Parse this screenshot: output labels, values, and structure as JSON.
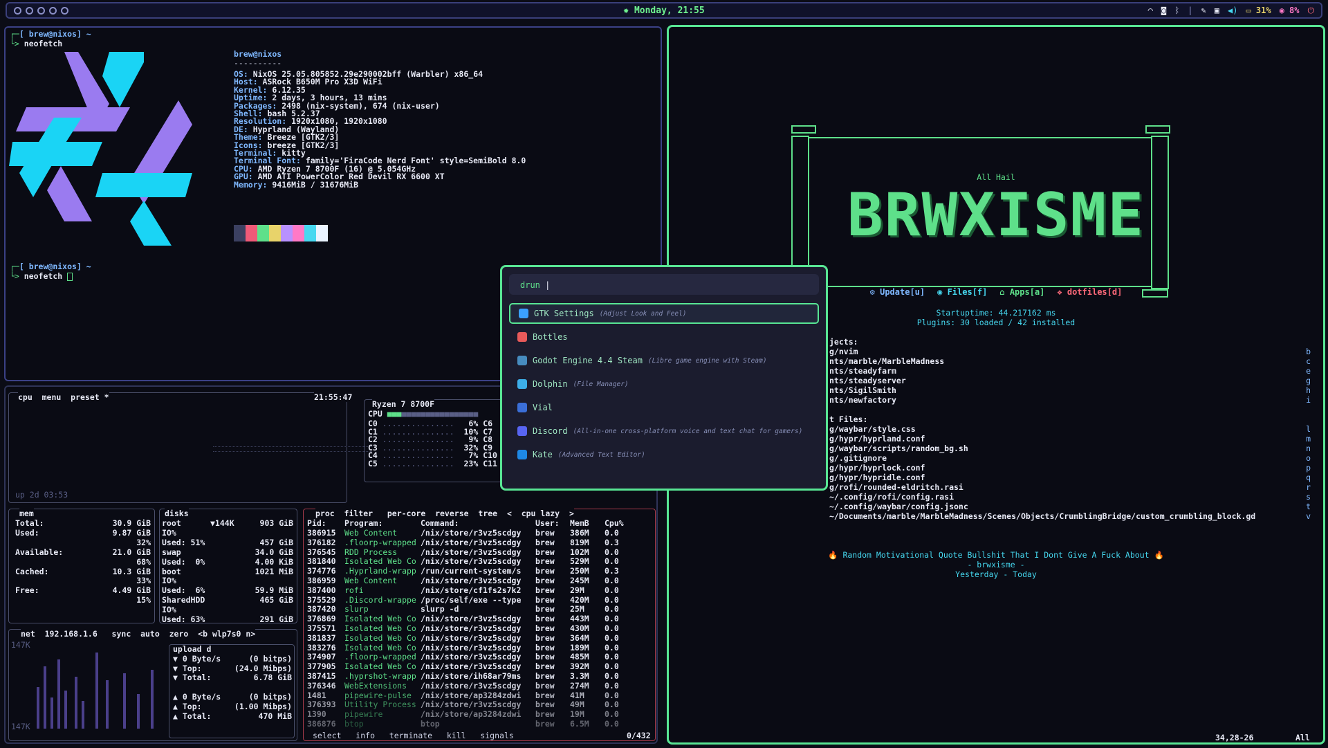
{
  "topbar": {
    "clock": "Monday, 21:55",
    "battery": "31%",
    "cpu": "8%"
  },
  "terminal": {
    "prompt1": "[ brew@nixos] ~",
    "cmd1": "neofetch",
    "user": "brew@nixos",
    "sep": "----------",
    "info": [
      [
        "OS:",
        "NixOS 25.05.805852.29e290002bff (Warbler) x86_64"
      ],
      [
        "Host:",
        "ASRock B650M Pro X3D WiFi"
      ],
      [
        "Kernel:",
        "6.12.35"
      ],
      [
        "Uptime:",
        "2 days, 3 hours, 13 mins"
      ],
      [
        "Packages:",
        "2498 (nix-system), 674 (nix-user)"
      ],
      [
        "Shell:",
        "bash 5.2.37"
      ],
      [
        "Resolution:",
        "1920x1080, 1920x1080"
      ],
      [
        "DE:",
        "Hyprland (Wayland)"
      ],
      [
        "Theme:",
        "Breeze [GTK2/3]"
      ],
      [
        "Icons:",
        "breeze [GTK2/3]"
      ],
      [
        "Terminal:",
        "kitty"
      ],
      [
        "Terminal Font:",
        "family='FiraCode Nerd Font' style=SemiBold 8.0"
      ],
      [
        "CPU:",
        "AMD Ryzen 7 8700F (16) @ 5.054GHz"
      ],
      [
        "GPU:",
        "AMD ATI PowerColor Red Devil RX 6600 XT"
      ],
      [
        "Memory:",
        "9416MiB / 31676MiB"
      ]
    ],
    "palette": [
      "#3b4061",
      "#f05a78",
      "#5ee08a",
      "#e8d36a",
      "#b891ff",
      "#ff79c6",
      "#46d8f0",
      "#eaf4ff"
    ],
    "prompt2": "[ brew@nixos] ~",
    "cmd2": "neofetch"
  },
  "btop": {
    "cpu_header": "cpu  menu  preset *",
    "time": "21:55:47",
    "uptime": "up 2d 03:53",
    "cpu_name": "Ryzen 7 8700F",
    "cores": [
      [
        "C0",
        "6%",
        "C6"
      ],
      [
        "C1",
        "10%",
        "C7"
      ],
      [
        "C2",
        "9%",
        "C8"
      ],
      [
        "C3",
        "32%",
        "C9"
      ],
      [
        "C4",
        "7%",
        "C10"
      ],
      [
        "C5",
        "23%",
        "C11"
      ]
    ],
    "mem": [
      [
        "Total:",
        "30.9 GiB"
      ],
      [
        "Used:",
        "9.87 GiB"
      ],
      [
        "",
        "32%"
      ],
      [
        "Available:",
        "21.0 GiB"
      ],
      [
        "",
        "68%"
      ],
      [
        "Cached:",
        "10.3 GiB"
      ],
      [
        "",
        "33%"
      ],
      [
        "Free:",
        "4.49 GiB"
      ],
      [
        "",
        "15%"
      ]
    ],
    "disks": [
      [
        "root",
        "▼144K",
        "903 GiB"
      ],
      [
        "IO%",
        "",
        ""
      ],
      [
        "Used: 51%",
        "",
        "457 GiB"
      ],
      [
        "swap",
        "",
        "34.0 GiB"
      ],
      [
        "Used:  0%",
        "",
        "4.00 KiB"
      ],
      [
        "boot",
        "",
        "1021 MiB"
      ],
      [
        "IO%",
        "",
        ""
      ],
      [
        "Used:  6%",
        "",
        "59.9 MiB"
      ],
      [
        "SharedHDD",
        "",
        "465 GiB"
      ],
      [
        "IO%",
        "",
        ""
      ],
      [
        "Used: 63%",
        "",
        "291 GiB"
      ]
    ],
    "net_header": "net  192.168.1.6   sync  auto  zero  <b wlp7s0 n>",
    "net_scale_top": "147K",
    "net_scale_bot": "147K",
    "net": [
      [
        "upload d",
        ""
      ],
      [
        "▼ 0 Byte/s",
        "(0 bitps)"
      ],
      [
        "▼ Top:",
        "(24.0 Mibps)"
      ],
      [
        "▼ Total:",
        "6.78 GiB"
      ],
      [
        "",
        ""
      ],
      [
        "▲ 0 Byte/s",
        "(0 bitps)"
      ],
      [
        "▲ Top:",
        "(1.00 Mibps)"
      ],
      [
        "▲ Total:",
        "470 MiB"
      ]
    ],
    "proc_header": "proc  filter   per-core  reverse  tree  <  cpu lazy  >",
    "proc_cols": [
      "Pid:",
      "Program:",
      "Command:",
      "User:",
      "MemB",
      "Cpu%"
    ],
    "procs": [
      [
        "386915",
        "Web Content",
        "/nix/store/r3vz5scdgy",
        "brew",
        "386M",
        "0.0"
      ],
      [
        "376182",
        ".floorp-wrapped",
        "/nix/store/r3vz5scdgy",
        "brew",
        "819M",
        "0.3"
      ],
      [
        "376545",
        "RDD Process",
        "/nix/store/r3vz5scdgy",
        "brew",
        "102M",
        "0.0"
      ],
      [
        "381840",
        "Isolated Web Co",
        "/nix/store/r3vz5scdgy",
        "brew",
        "529M",
        "0.0"
      ],
      [
        "374776",
        ".Hyprland-wrapp",
        "/run/current-system/s",
        "brew",
        "250M",
        "0.3"
      ],
      [
        "386959",
        "Web Content",
        "/nix/store/r3vz5scdgy",
        "brew",
        "245M",
        "0.0"
      ],
      [
        "387400",
        "rofi",
        "/nix/store/cf1fs2s7k2",
        "brew",
        "29M",
        "0.0"
      ],
      [
        "375529",
        ".Discord-wrappe",
        "/proc/self/exe --type",
        "brew",
        "420M",
        "0.0"
      ],
      [
        "387420",
        "slurp",
        "slurp -d",
        "brew",
        "25M",
        "0.0"
      ],
      [
        "376869",
        "Isolated Web Co",
        "/nix/store/r3vz5scdgy",
        "brew",
        "443M",
        "0.0"
      ],
      [
        "375571",
        "Isolated Web Co",
        "/nix/store/r3vz5scdgy",
        "brew",
        "430M",
        "0.0"
      ],
      [
        "381837",
        "Isolated Web Co",
        "/nix/store/r3vz5scdgy",
        "brew",
        "364M",
        "0.0"
      ],
      [
        "383276",
        "Isolated Web Co",
        "/nix/store/r3vz5scdgy",
        "brew",
        "189M",
        "0.0"
      ],
      [
        "374907",
        ".floorp-wrapped",
        "/nix/store/r3vz5scdgy",
        "brew",
        "485M",
        "0.0"
      ],
      [
        "377905",
        "Isolated Web Co",
        "/nix/store/r3vz5scdgy",
        "brew",
        "392M",
        "0.0"
      ],
      [
        "387415",
        ".hyprshot-wrapp",
        "/nix/store/ih68ar79ms",
        "brew",
        "3.3M",
        "0.0"
      ],
      [
        "376346",
        "WebExtensions",
        "/nix/store/r3vz5scdgy",
        "brew",
        "274M",
        "0.0"
      ],
      [
        "1481",
        "pipewire-pulse",
        "/nix/store/ap3284zdwi",
        "brew",
        "41M",
        "0.0"
      ],
      [
        "376393",
        "Utility Process",
        "/nix/store/r3vz5scdgy",
        "brew",
        "49M",
        "0.0"
      ],
      [
        "1390",
        "pipewire",
        "/nix/store/ap3284zdwi",
        "brew",
        "19M",
        "0.0"
      ],
      [
        "386876",
        "btop",
        "btop",
        "brew",
        "6.5M",
        "0.0"
      ]
    ],
    "proc_footer": "select   info   terminate   kill   signals",
    "proc_count": "0/432"
  },
  "launcher": {
    "mode": "drun",
    "items": [
      {
        "name": "GTK Settings",
        "desc": "(Adjust Look and Feel)",
        "color": "#3ba0ff"
      },
      {
        "name": "Bottles",
        "desc": "",
        "color": "#e85a5a"
      },
      {
        "name": "Godot Engine 4.4 Steam",
        "desc": "(Libre game engine with Steam)",
        "color": "#478cbf"
      },
      {
        "name": "Dolphin",
        "desc": "(File Manager)",
        "color": "#3daee9"
      },
      {
        "name": "Vial",
        "desc": "",
        "color": "#3b6fd8"
      },
      {
        "name": "Discord",
        "desc": "(All-in-one cross-platform voice and text chat for gamers)",
        "color": "#5865f2"
      },
      {
        "name": "Kate",
        "desc": "(Advanced Text Editor)",
        "color": "#1e88e5"
      }
    ]
  },
  "nvim": {
    "tagline": "All Hail",
    "banner": "BRWXISME",
    "buttons": [
      "Update[u]",
      "Files[f]",
      "Apps[a]",
      "dotfiles[d]"
    ],
    "startup": "Startuptime: 44.217162 ms",
    "plugins": "Plugins: 30 loaded / 42 installed",
    "projects_label": "jects:",
    "projects": [
      [
        "g/nvim",
        "b"
      ],
      [
        "nts/marble/MarbleMadness",
        "c"
      ],
      [
        "nts/steadyfarm",
        "e"
      ],
      [
        "nts/steadyserver",
        "g"
      ],
      [
        "nts/SigilSmith",
        "h"
      ],
      [
        "nts/newfactory",
        "i"
      ]
    ],
    "files_label": "t Files:",
    "files": [
      [
        "g/waybar/style.css",
        "l"
      ],
      [
        "g/hypr/hyprland.conf",
        "m"
      ],
      [
        "g/waybar/scripts/random_bg.sh",
        "n"
      ],
      [
        "g/.gitignore",
        "o"
      ],
      [
        "g/hypr/hyprlock.conf",
        "p"
      ],
      [
        "g/hypr/hypridle.conf",
        "q"
      ],
      [
        "g/rofi/rounded-eldritch.rasi",
        "r"
      ],
      [
        "~/.config/rofi/config.rasi",
        "s"
      ],
      [
        "~/.config/waybar/config.jsonc",
        "t"
      ],
      [
        "~/Documents/marble/MarbleMadness/Scenes/Objects/CrumblingBridge/custom_crumbling_block.gd",
        "v"
      ]
    ],
    "quote": "Random Motivational Quote Bullshit That I Dont Give A Fuck About",
    "author": "- brwxisme -",
    "when": "Yesterday - Today",
    "status_pos": "34,28-26",
    "status_all": "All"
  }
}
